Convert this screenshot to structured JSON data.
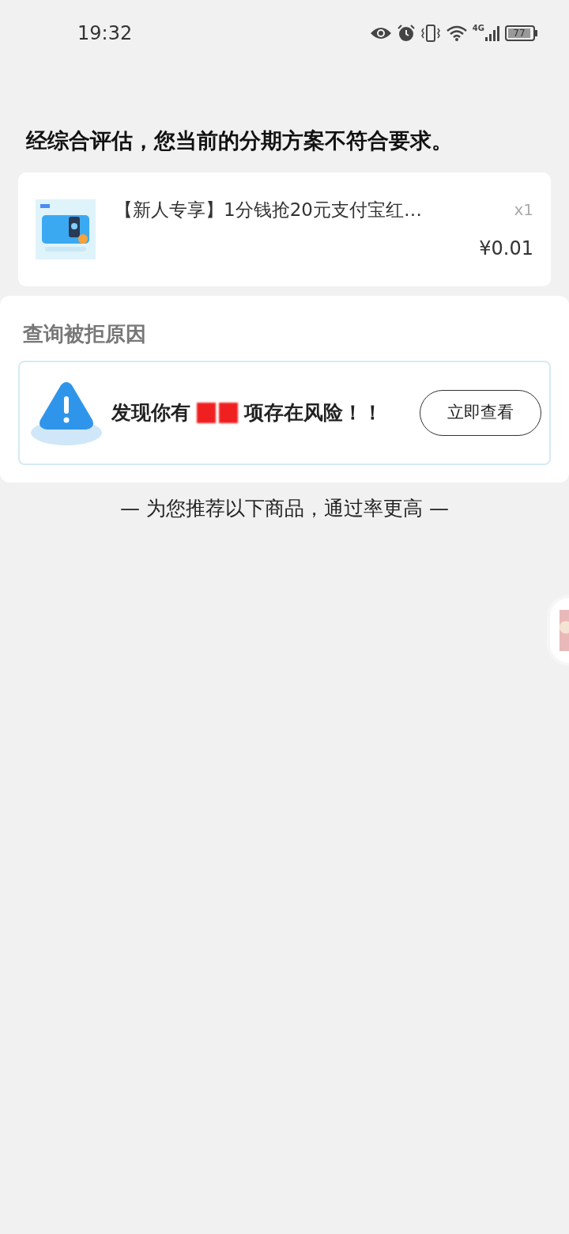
{
  "status_bar": {
    "time": "19:32",
    "network": "4G",
    "battery": "77"
  },
  "headline": "经综合评估，您当前的分期方案不符合要求。",
  "product": {
    "title": "【新人专享】1分钱抢20元支付宝红…",
    "quantity": "x1",
    "price": "¥0.01"
  },
  "reason_section": {
    "title": "查询被拒原因",
    "risk_text_before": "发现你有",
    "risk_text_after": "项存在风险！！",
    "redacted": true,
    "button": "立即查看"
  },
  "recommend_divider": "— 为您推荐以下商品，通过率更高 —"
}
